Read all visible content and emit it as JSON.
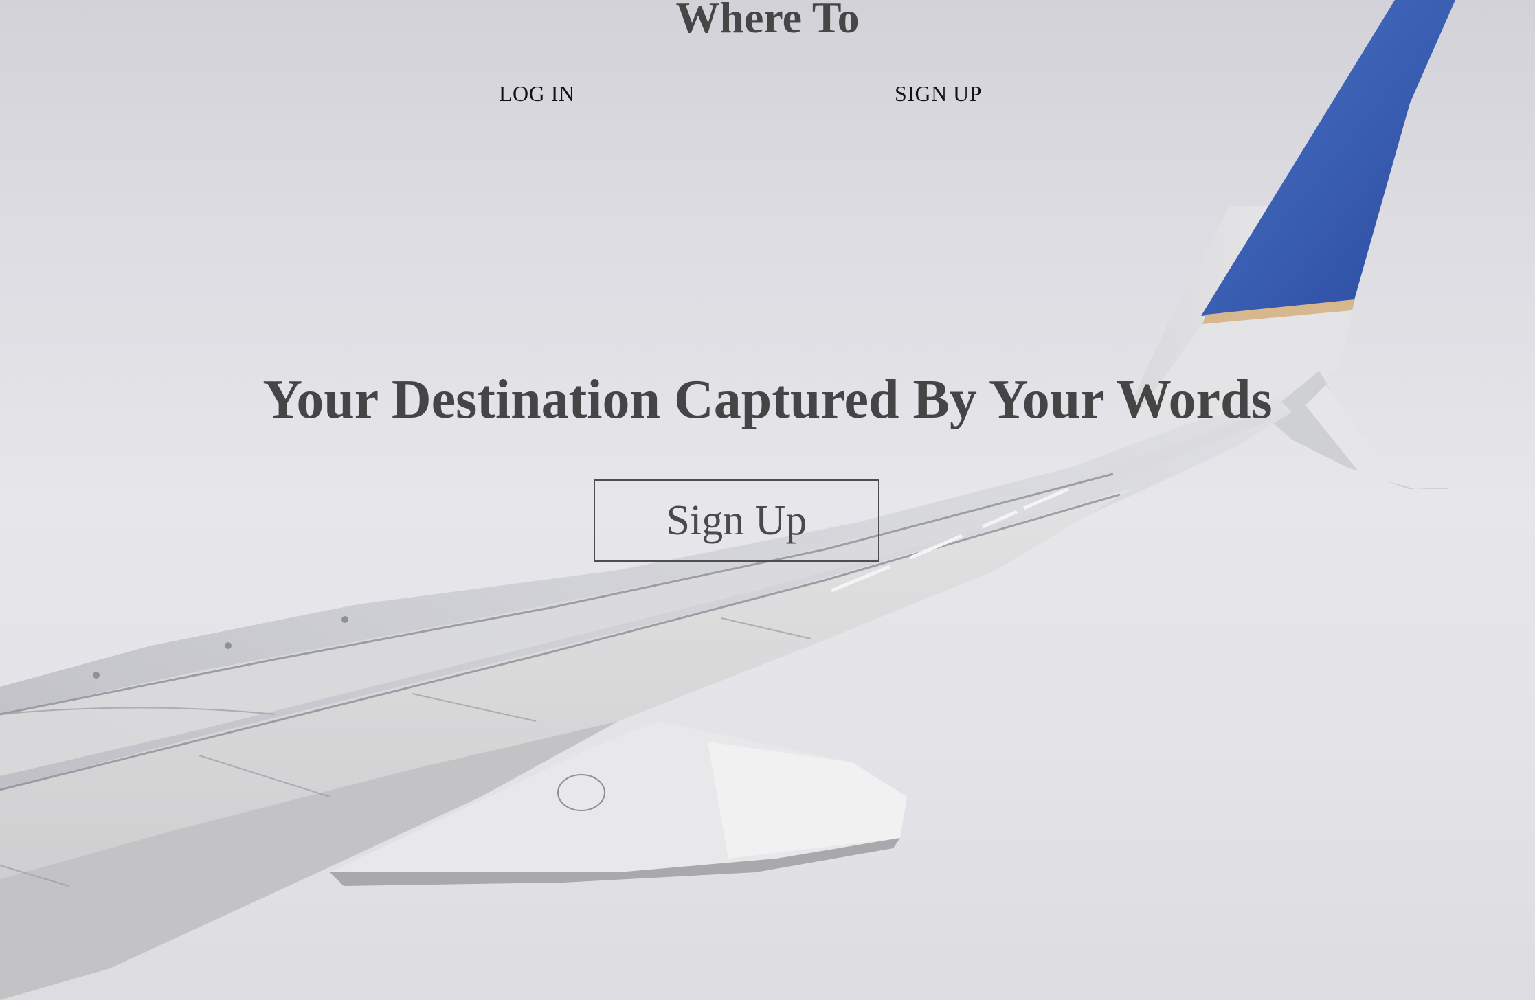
{
  "header": {
    "site_title": "Where To",
    "nav": {
      "login_label": "LOG IN",
      "signup_label": "SIGN UP"
    }
  },
  "hero": {
    "headline": "Your Destination Captured By Your Words",
    "cta_label": "Sign Up",
    "background_image": "airplane-wing-over-clouds"
  },
  "colors": {
    "text_dark": "#454545",
    "wing_accent_blue": "#2f57b3",
    "sky": "#e4e3e7"
  }
}
